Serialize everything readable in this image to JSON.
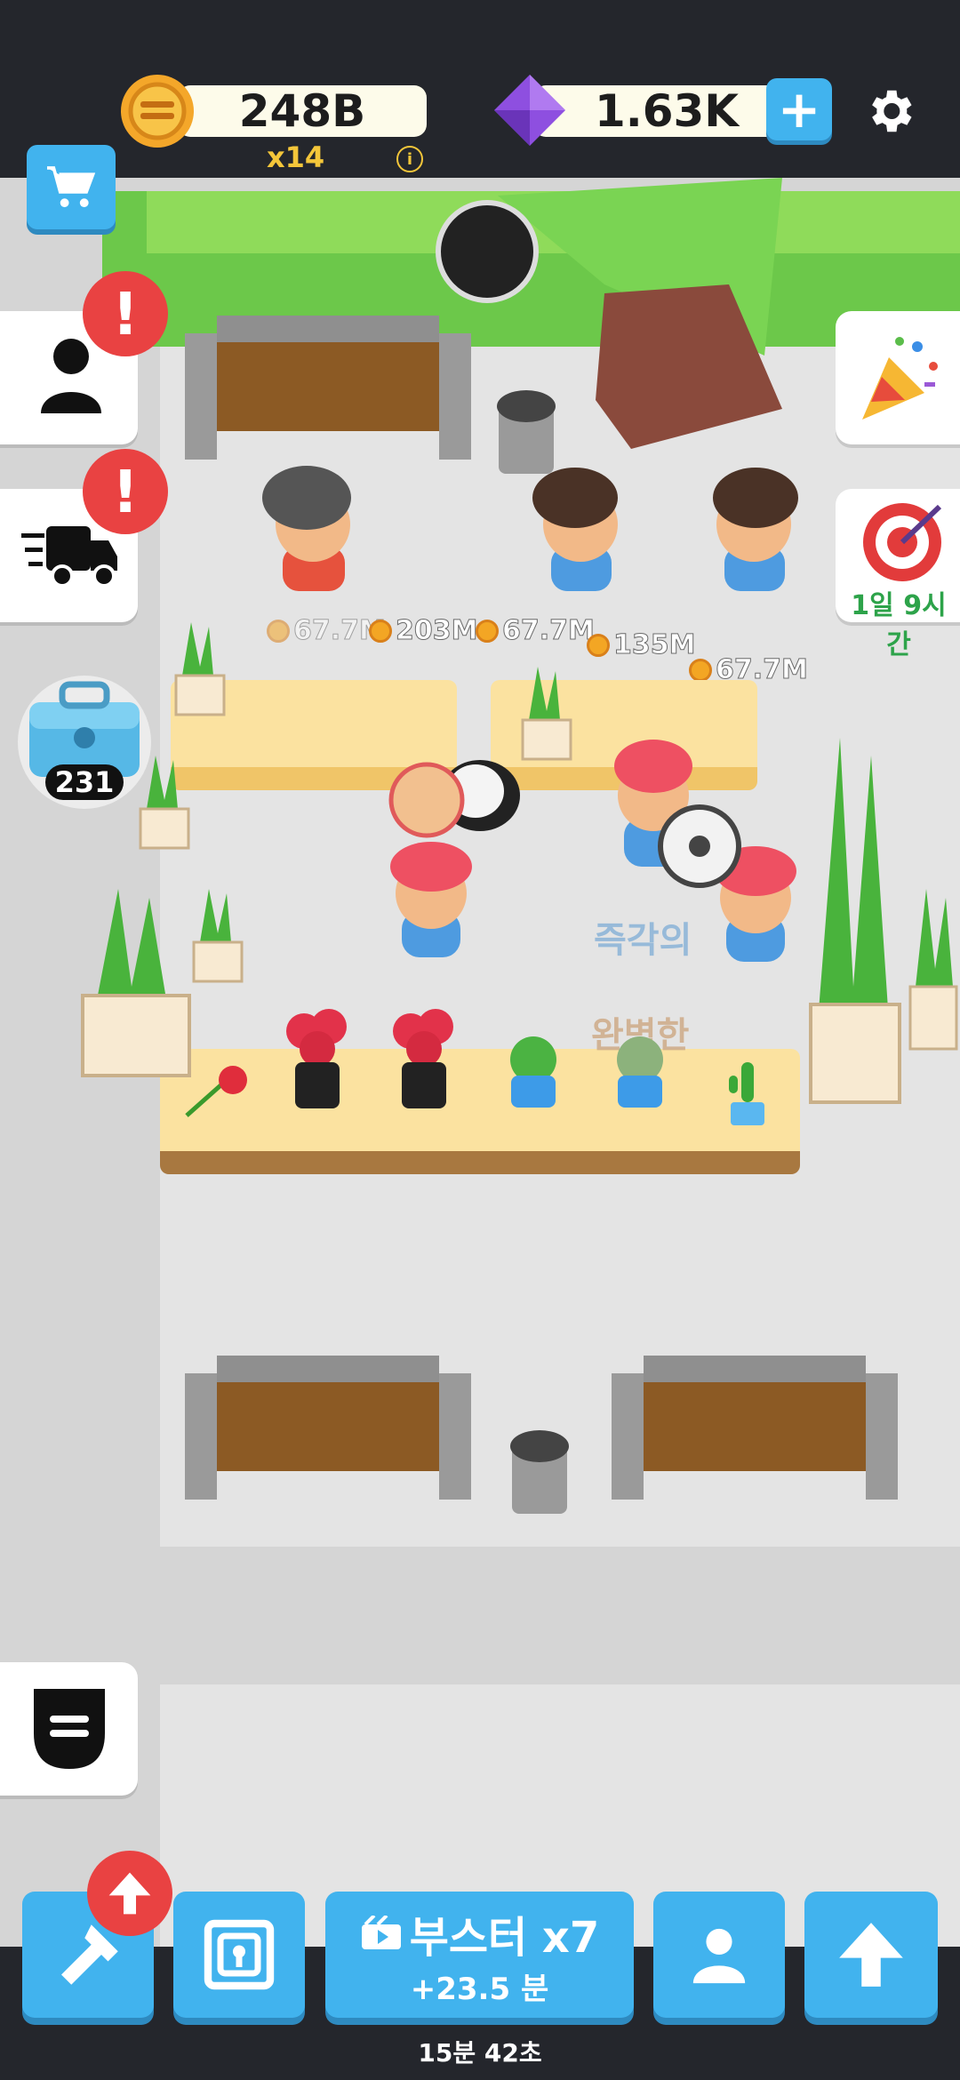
{
  "hud": {
    "coins": "248B",
    "multiplier": "x14",
    "gems": "1.63K",
    "info_glyph": "i"
  },
  "side": {
    "chest_count": "231",
    "alert_glyph": "!"
  },
  "goal": {
    "timer": "1일 9시간"
  },
  "floaters": [
    "67.7M",
    "203M",
    "67.7M",
    "135M",
    "67.7M"
  ],
  "world_text": {
    "text1": "즉각의",
    "text2": "완벽한"
  },
  "boost": {
    "label": "부스터 x7",
    "sub": "+23.5 분"
  },
  "footer": {
    "timer": "15분 42초"
  }
}
